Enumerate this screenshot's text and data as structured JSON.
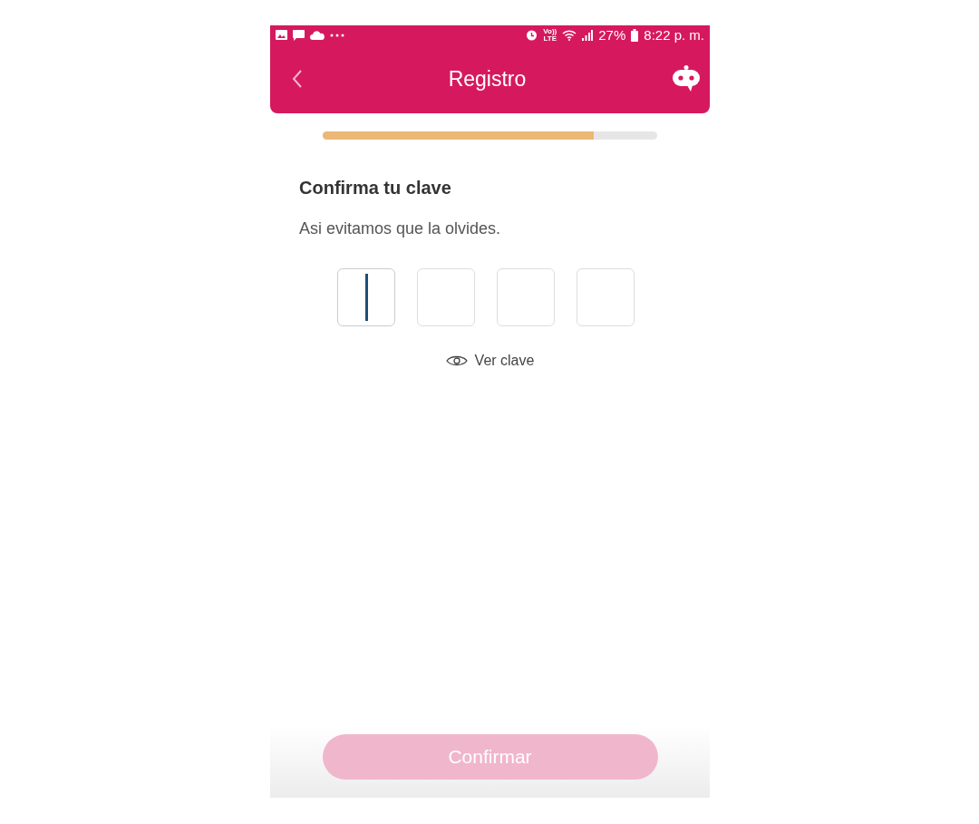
{
  "status_bar": {
    "volte": [
      "Vo))",
      "LTE"
    ],
    "battery": "27%",
    "time": "8:22 p. m."
  },
  "header": {
    "title": "Registro"
  },
  "progress": {
    "level": 0.81
  },
  "heading": "Confirma tu clave",
  "subtitle": "Asi evitamos que la olvides.",
  "pin_boxes": [
    {
      "focused": true
    },
    {
      "focused": false
    },
    {
      "focused": false
    },
    {
      "focused": false
    }
  ],
  "show_password": {
    "label": "Ver clave"
  },
  "confirm_button": {
    "label": "Confirmar",
    "disabled": true
  }
}
